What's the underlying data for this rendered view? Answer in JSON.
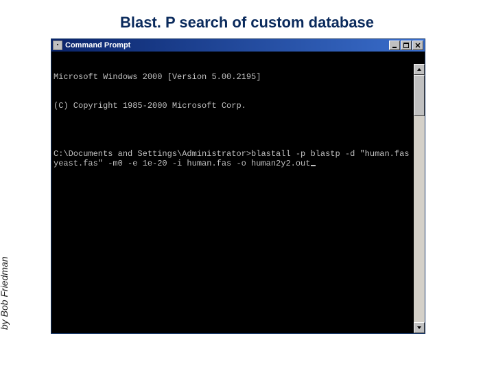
{
  "slide": {
    "title": "Blast. P search of custom database",
    "author": "by Bob Friedman"
  },
  "window": {
    "title": "Command Prompt",
    "icon_glyph": "C:\\"
  },
  "terminal": {
    "lines": [
      "Microsoft Windows 2000 [Version 5.00.2195]",
      "(C) Copyright 1985-2000 Microsoft Corp.",
      "",
      "C:\\Documents and Settings\\Administrator>blastall -p blastp -d \"human.fas yeast.fas\" -m0 -e 1e-20 -i human.fas -o human2y2.out"
    ]
  }
}
